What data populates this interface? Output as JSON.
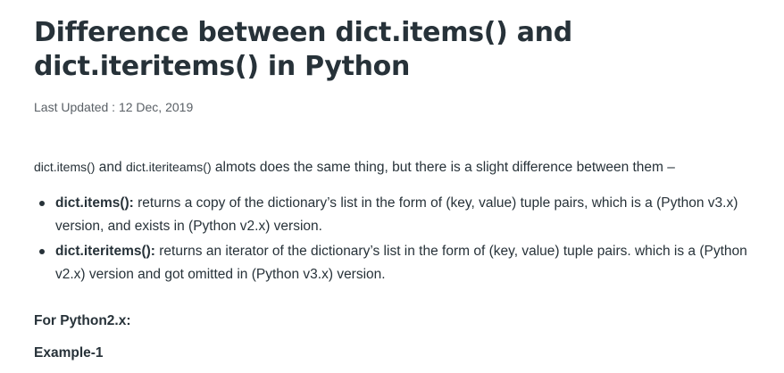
{
  "article": {
    "title": "Difference between dict.items() and dict.iteritems() in Python",
    "last_updated": "Last Updated : 12 Dec, 2019",
    "intro": {
      "code1": "dict.items()",
      "and": " and ",
      "code2": "dict.iteriteams()",
      "rest": " almots does the same thing, but there is a slight difference between them –"
    },
    "points": [
      {
        "term": "dict.items():",
        "text": " returns a copy of the dictionary’s list in the form of (key, value) tuple pairs, which is a (Python v3.x) version, and exists in (Python v2.x) version."
      },
      {
        "term": "dict.iteritems():",
        "text": " returns an iterator of the dictionary’s list in the form of (key, value) tuple pairs. which is a (Python v2.x) version and got omitted in (Python v3.x) version."
      }
    ],
    "section_python2": "For Python2.x:",
    "section_example1": "Example-1"
  }
}
